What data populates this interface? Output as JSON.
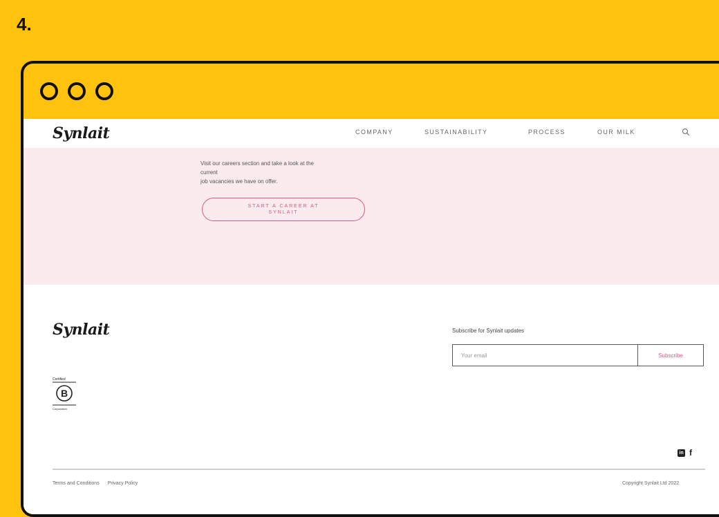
{
  "step": {
    "number": "4."
  },
  "site": {
    "logo": "Synlait",
    "nav": [
      "COMPANY",
      "SUSTAINABILITY",
      "PROCESS",
      "OUR MILK"
    ]
  },
  "careers": {
    "text_line1": "Visit our careers section and take a look at the",
    "text_line2": "current",
    "text_line3": "job vacancies we have on offer.",
    "button_label": "START A CAREER AT SYNLAIT"
  },
  "footer": {
    "logo": "Synlait",
    "bcorp_top": "Certified",
    "bcorp_bottom": "Corporation",
    "subscribe_label": "Subscribe for Synlait updates",
    "email_placeholder": "Your email",
    "subscribe_button": "Subscribe",
    "links": [
      "Terms and Conditions",
      "Privacy Policy"
    ],
    "copyright": "Copyright Synlait Ltd 2022"
  },
  "colors": {
    "background": "#FFC20E",
    "pink_section": "#FBEAEE",
    "accent": "#D25A86"
  },
  "icons": [
    "search-icon",
    "linkedin-icon",
    "facebook-icon"
  ]
}
